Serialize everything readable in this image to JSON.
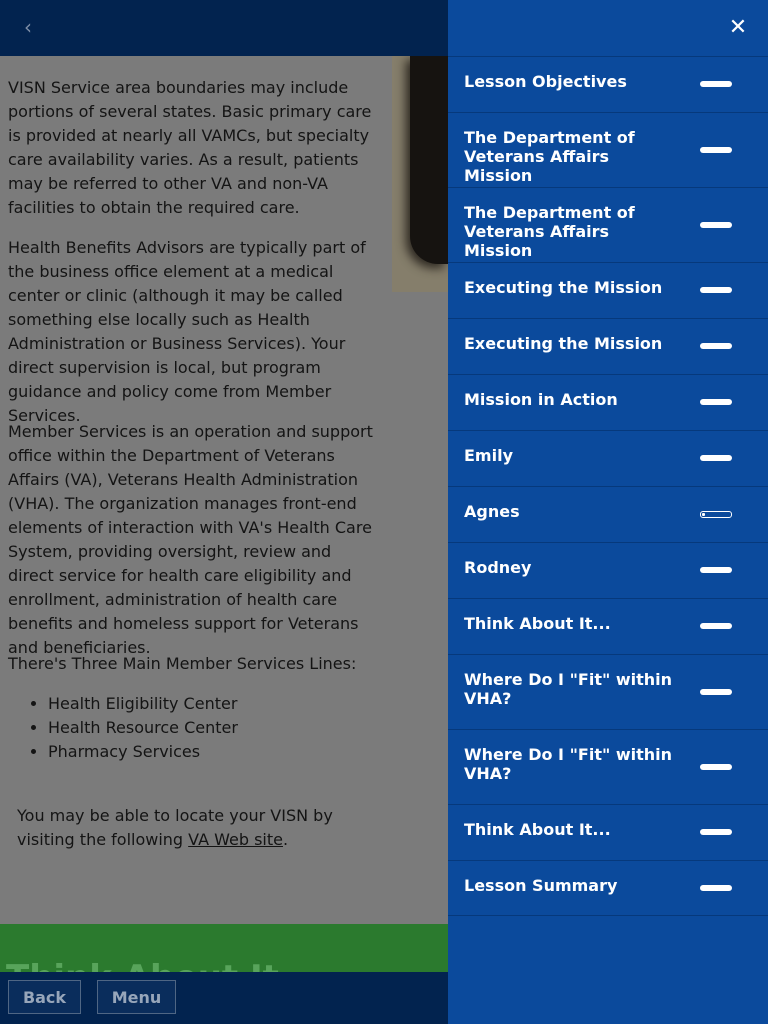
{
  "page": {
    "back_chevron": "‹",
    "partial_heading": "",
    "paragraphs": [
      "VISN Service area boundaries may include portions of several states. Basic primary care is provided at nearly all VAMCs, but specialty care availability varies. As a result, patients may be referred to other VA and non-VA facilities to obtain the required care.",
      "Health Benefits Advisors are typically part of the business office element at a medical center or clinic (although it may be called something else locally such as Health Administration or Business Services). Your direct supervision is local, but program guidance and policy come from Member Services.",
      "Member Services is an operation and support office within the Department of Veterans Affairs (VA), Veterans Health Administration (VHA). The organization manages front-end elements of interaction with VA's Health Care System, providing oversight, review and direct service for health care eligibility and enrollment, administration of health care benefits and homeless support for Veterans and beneficiaries."
    ],
    "lines_intro": "There's Three Main Member Services Lines:",
    "lines": [
      "Health Eligibility Center",
      "Health Resource Center",
      "Pharmacy Services"
    ],
    "visn_note_prefix": "You may be able to locate your VISN by visiting the following ",
    "visn_link": "VA Web site",
    "visn_note_suffix": ".",
    "green_band_text": "Think About It..."
  },
  "bottom_bar": {
    "back_label": "Back",
    "menu_label": "Menu"
  },
  "menu": {
    "close_icon": "✕",
    "items": [
      {
        "label": "Lesson Objectives",
        "status": "complete"
      },
      {
        "label": "The Department of Veterans Affairs Mission",
        "status": "complete"
      },
      {
        "label": "The Department of Veterans Affairs Mission",
        "status": "complete"
      },
      {
        "label": "Executing the Mission",
        "status": "complete"
      },
      {
        "label": "Executing the Mission",
        "status": "complete"
      },
      {
        "label": "Mission in Action",
        "status": "complete"
      },
      {
        "label": "Emily",
        "status": "complete"
      },
      {
        "label": "Agnes",
        "status": "in-progress"
      },
      {
        "label": "Rodney",
        "status": "complete"
      },
      {
        "label": "Think About It...",
        "status": "complete"
      },
      {
        "label": "Where Do I \"Fit\" within VHA?",
        "status": "complete"
      },
      {
        "label": "Where Do I \"Fit\" within VHA?",
        "status": "complete"
      },
      {
        "label": "Think About It...",
        "status": "complete"
      },
      {
        "label": "Lesson Summary",
        "status": "complete"
      }
    ]
  },
  "colors": {
    "menu_panel": "#0b4a9c",
    "header_bar": "#02234f",
    "green_band": "#2b7a2e"
  }
}
